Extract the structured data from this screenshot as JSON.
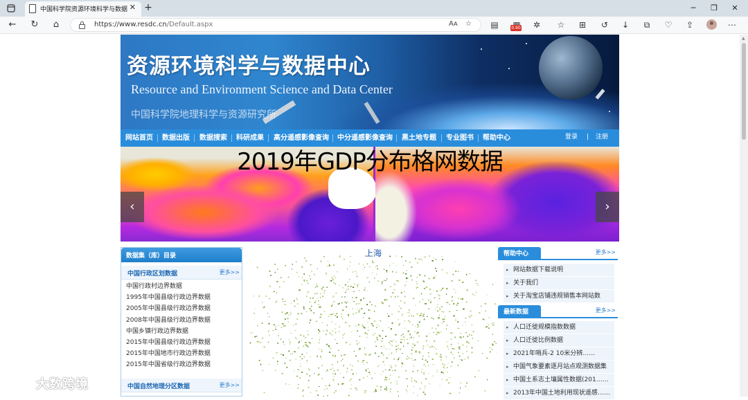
{
  "browser": {
    "tab_title": "中国科学院资源环境科学与数据中心",
    "url_host": "https://www.resdc.cn",
    "url_path": "/Default.aspx",
    "ext_badge": "0.90",
    "read_aloud": "Aᴀ"
  },
  "site": {
    "title_cn": "资源环境科学与数据中心",
    "title_en": "Resource and Environment Science and Data Center",
    "subtitle": "中国科学院地理科学与资源研究所",
    "nav": [
      "网站首页",
      "数据出版",
      "数据搜索",
      "科研成果",
      "高分遥感影像查询",
      "中分遥感影像查询",
      "黑土地专题",
      "专业图书",
      "帮助中心"
    ],
    "login": "登录",
    "login_sep": "|",
    "register": "注册"
  },
  "slider": {
    "title": "2019年GDP分布格网数据",
    "prev": "‹",
    "next": "›"
  },
  "left": {
    "header": "数据集（库）目录",
    "section1": "中国行政区划数据",
    "more": "更多>>",
    "items": [
      "中国行政村边界数据",
      "1995年中国县级行政边界数据",
      "2005年中国县级行政边界数据",
      "2008年中国县级行政边界数据",
      "中国乡镇行政边界数据",
      "2015年中国县级行政边界数据",
      "2015年中国地市行政边界数据",
      "2015年中国省级行政边界数据"
    ],
    "section2": "中国自然地理分区数据"
  },
  "center": {
    "title": "上海"
  },
  "right": {
    "help_title": "帮助中心",
    "help_more": "更多>>",
    "help_items": [
      "网站数据下载说明",
      "关于我们",
      "关于淘宝店铺违规销售本网站数"
    ],
    "news_title": "最新数据",
    "news_more": "更多>>",
    "news_items": [
      "人口迁徙规模指数数据",
      "人口迁徙比例数据",
      "2021年哨兵-2 10米分辨……",
      "中国气象要素逐月站点观测数据集",
      "中国土系志土壤属性数据(201……",
      "2013年中国土地利用现状遥感……"
    ]
  },
  "watermark": {
    "text": "大数跨境"
  }
}
